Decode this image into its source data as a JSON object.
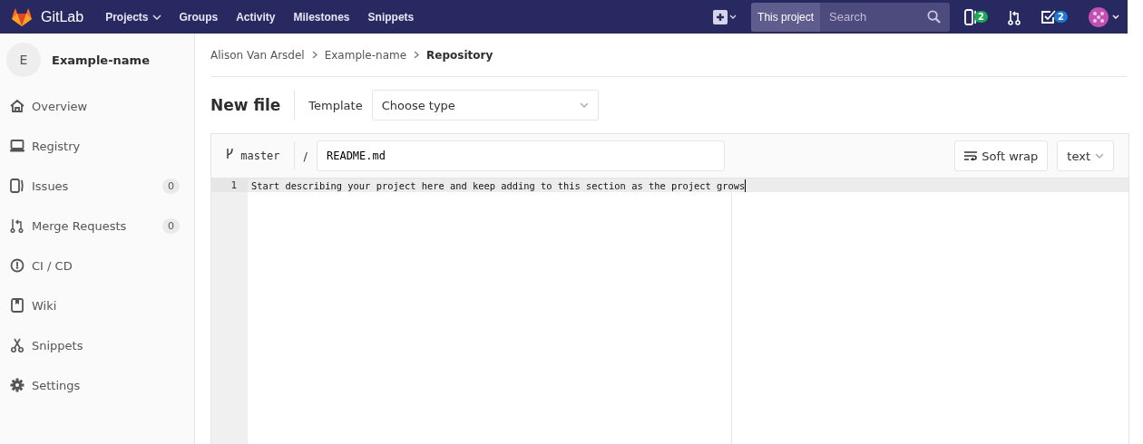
{
  "navbar": {
    "brand": "GitLab",
    "links": [
      {
        "label": "Projects",
        "dropdown": true
      },
      {
        "label": "Groups",
        "dropdown": false
      },
      {
        "label": "Activity",
        "dropdown": false
      },
      {
        "label": "Milestones",
        "dropdown": false
      },
      {
        "label": "Snippets",
        "dropdown": false
      }
    ],
    "search": {
      "scope": "This project",
      "placeholder": "Search"
    },
    "issues_count": "2",
    "todos_count": "2"
  },
  "sidebar": {
    "avatar_letter": "E",
    "project": "Example-name",
    "items": [
      {
        "kind": "home",
        "label": "Overview"
      },
      {
        "kind": "registry",
        "label": "Registry"
      },
      {
        "kind": "issues",
        "label": "Issues",
        "count": "0"
      },
      {
        "kind": "merge",
        "label": "Merge Requests",
        "count": "0"
      },
      {
        "kind": "ci",
        "label": "CI / CD"
      },
      {
        "kind": "wiki",
        "label": "Wiki"
      },
      {
        "kind": "snippets",
        "label": "Snippets"
      },
      {
        "kind": "settings",
        "label": "Settings"
      }
    ]
  },
  "breadcrumbs": [
    "Alison Van Arsdel",
    "Example-name",
    "Repository"
  ],
  "title": "New file",
  "template": {
    "label": "Template",
    "value": "Choose type"
  },
  "editor": {
    "branch": "master",
    "separator": "/",
    "file_name": "README.md",
    "soft_wrap": "Soft wrap",
    "mode": "text",
    "lines": [
      {
        "number": "1",
        "text": "Start describing your project here and keep adding to this section as the project grows"
      }
    ]
  }
}
